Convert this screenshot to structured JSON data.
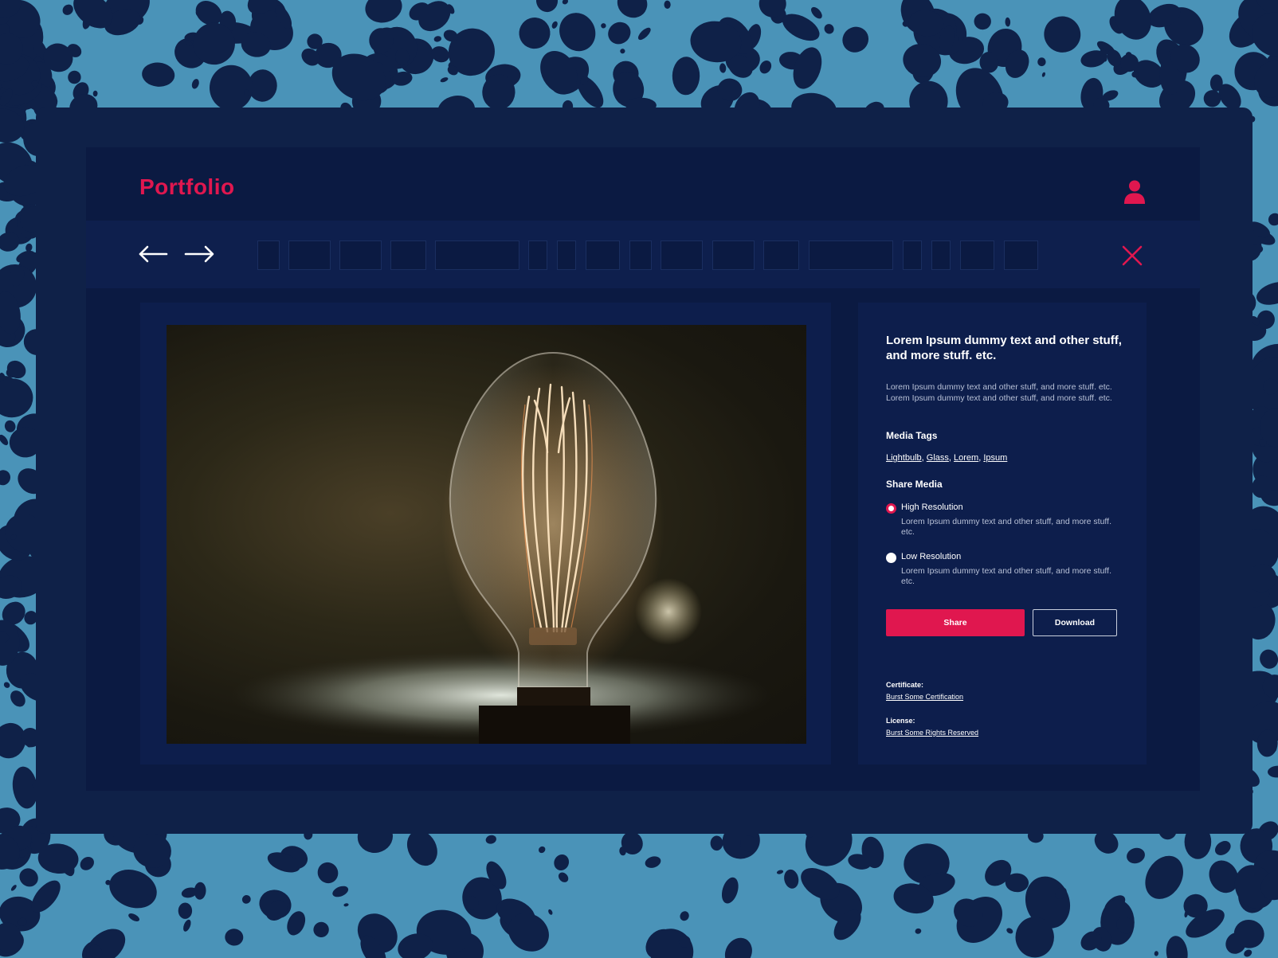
{
  "colors": {
    "accent": "#e0174f",
    "window_bg": "#0b1a42",
    "panel_bg": "#0d1e4c",
    "backdrop_light": "#4a93b8",
    "backdrop_dark": "#0f2148"
  },
  "header": {
    "logo": "Portfolio",
    "user_icon": "user-icon"
  },
  "toolbar": {
    "back_icon": "arrow-left-icon",
    "forward_icon": "arrow-right-icon",
    "close_icon": "close-icon",
    "thumbnail_count": 18
  },
  "media": {
    "image": "lightbulb-photo"
  },
  "details": {
    "title": "Lorem Ipsum dummy text and other stuff, and more stuff. etc.",
    "description": "Lorem Ipsum dummy text and other stuff, and more stuff. etc. Lorem Ipsum dummy text and other stuff, and more stuff. etc.",
    "tags_heading": "Media Tags",
    "tags": [
      "Lightbulb",
      "Glass",
      "Lorem",
      "Ipsum"
    ],
    "share_heading": "Share Media",
    "options": [
      {
        "label": "High Resolution",
        "description": "Lorem Ipsum dummy text and other stuff, and more stuff. etc.",
        "selected": true
      },
      {
        "label": "Low Resolution",
        "description": "Lorem Ipsum dummy text and other stuff, and more stuff. etc.",
        "selected": false
      }
    ],
    "share_label": "Share",
    "download_label": "Download",
    "certificate_label": "Certificate:",
    "certificate_value": "Burst Some Certification",
    "license_label": "License:",
    "license_value": "Burst Some Rights Reserved"
  }
}
